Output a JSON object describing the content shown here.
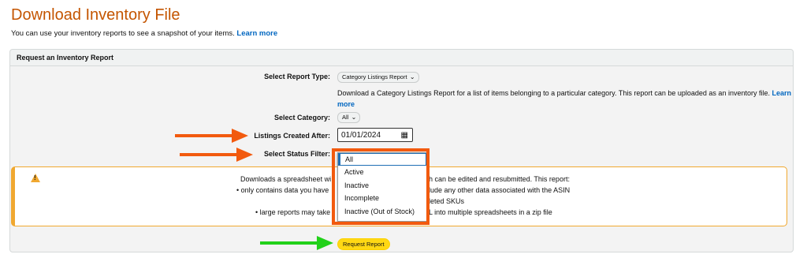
{
  "page": {
    "title": "Download Inventory File",
    "intro_text": "You can use your inventory reports to see a snapshot of your items.",
    "intro_link": "Learn more"
  },
  "panel": {
    "heading": "Request an Inventory Report",
    "report_type": {
      "label": "Select Report Type:",
      "value": "Category Listings Report",
      "description": "Download a Category Listings Report for a list of items belonging to a particular category. This report can be uploaded as an inventory file.",
      "description_link": "Learn more"
    },
    "category": {
      "label": "Select Category:",
      "value": "All"
    },
    "listings_created_after": {
      "label": "Listings Created After:",
      "value": "01/01/2024"
    },
    "status_filter": {
      "label": "Select Status Filter:",
      "options": [
        "All",
        "Active",
        "Inactive",
        "Incomplete",
        "Inactive (Out of Stock)"
      ],
      "selected": "All"
    },
    "warning": {
      "line1_left": "Downloads a spreadsheet wi",
      "line1_right": "h can be edited and resubmitted. This report:",
      "line2_left": "• only contains data you have",
      "line2_right": "lude any other data associated with the ASIN",
      "line3_right": "leted SKUs",
      "line4_left": "• large reports may take",
      "line4_right": "L into multiple spreadsheets in a zip file"
    },
    "request_button": "Request Report"
  },
  "annotations": {
    "arrow_color_orange": "#f25a0e",
    "arrow_color_green": "#22d11a",
    "highlight_color": "#f25a0e"
  }
}
